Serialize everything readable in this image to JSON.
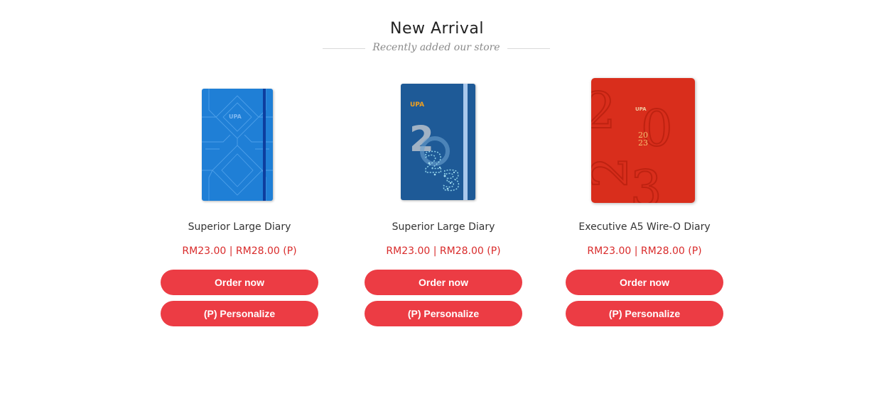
{
  "section": {
    "title": "New Arrival",
    "subtitle": "Recently added our store"
  },
  "products": [
    {
      "name": "Superior Large Diary",
      "price": "RM23.00 | RM28.00 (P)",
      "order_label": "Order now",
      "personalize_label": "(P) Personalize",
      "cover_logo": "UPA"
    },
    {
      "name": "Superior Large Diary",
      "price": "RM23.00 | RM28.00 (P)",
      "order_label": "Order now",
      "personalize_label": "(P) Personalize",
      "cover_logo": "UPA"
    },
    {
      "name": "Executive A5 Wire-O Diary",
      "price": "RM23.00 | RM28.00 (P)",
      "order_label": "Order now",
      "personalize_label": "(P) Personalize",
      "cover_logo": "UPA",
      "cover_year_top": "20",
      "cover_year_bottom": "23"
    }
  ],
  "colors": {
    "button": "#ec3c44",
    "price": "#d92b2b"
  }
}
